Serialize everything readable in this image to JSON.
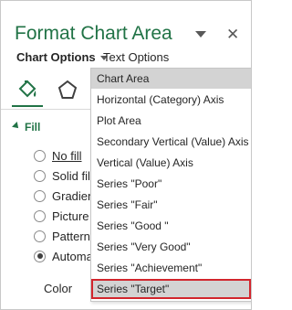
{
  "pane": {
    "title": "Format Chart Area",
    "close_icon": "✕"
  },
  "options": {
    "chart_options": "Chart Options",
    "text_options": "Text Options"
  },
  "icons": [
    "fill-bucket-icon",
    "pentagon-icon"
  ],
  "fill": {
    "header": "Fill",
    "radios": [
      {
        "label": "No fill",
        "checked": false
      },
      {
        "label": "Solid fill",
        "checked": false
      },
      {
        "label": "Gradient",
        "checked": false
      },
      {
        "label": "Picture o",
        "checked": false
      },
      {
        "label": "Pattern f",
        "checked": false
      },
      {
        "label": "Automat",
        "checked": true
      }
    ]
  },
  "color_label": "Color",
  "dropdown": {
    "items": [
      "Chart Area",
      "Horizontal (Category) Axis",
      "Plot Area",
      "Secondary Vertical (Value) Axis",
      "Vertical (Value) Axis",
      "Series \"Poor\"",
      "Series \"Fair\"",
      "Series \"Good \"",
      "Series \"Very Good\"",
      "Series \"Achievement\"",
      "Series \"Target\""
    ],
    "selected_index": 0,
    "highlighted_index": 10
  },
  "colors": {
    "accent": "#217346",
    "highlight_border": "#d2262d",
    "selected_bg": "#d3d3d3"
  }
}
